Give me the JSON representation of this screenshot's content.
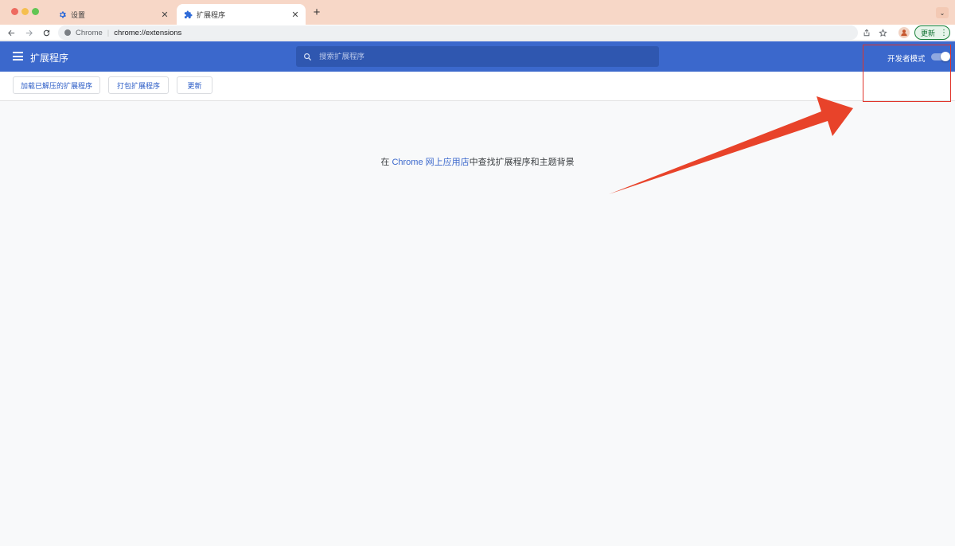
{
  "browser": {
    "tabs": [
      {
        "title": "设置",
        "icon": "gear-icon",
        "active": false
      },
      {
        "title": "扩展程序",
        "icon": "puzzle-icon",
        "active": true
      }
    ],
    "new_tab_symbol": "+",
    "tab_search_symbol": "⌄",
    "omnibox": {
      "site_label": "Chrome",
      "url": "chrome://extensions"
    },
    "update_button_label": "更新"
  },
  "extensions_page": {
    "title": "扩展程序",
    "search_placeholder": "搜索扩展程序",
    "developer_mode_label": "开发者模式",
    "developer_mode_on": true,
    "dev_buttons": {
      "load_unpacked": "加载已解压的扩展程序",
      "pack": "打包扩展程序",
      "update": "更新"
    },
    "empty_message": {
      "prefix": "在 ",
      "store_link": "Chrome 网上应用店",
      "suffix": "中查找扩展程序和主题背景"
    }
  },
  "colors": {
    "header_blue": "#3b68cc",
    "annotation_red": "#e0342a",
    "tabstrip": "#f7d7c7"
  }
}
